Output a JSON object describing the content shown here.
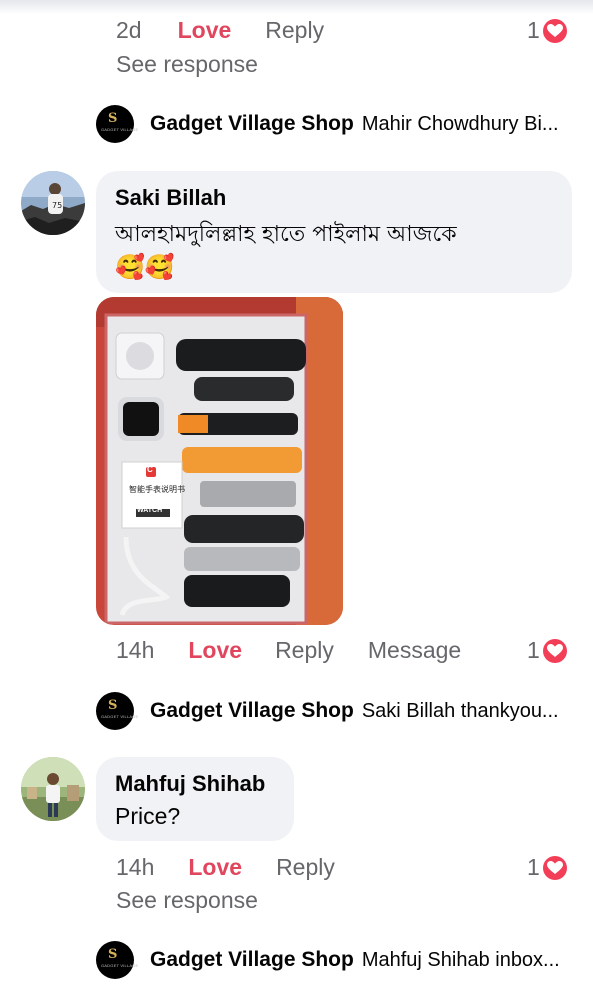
{
  "comments": [
    {
      "time": "2d",
      "love_label": "Love",
      "reply_label": "Reply",
      "reaction_count": "1",
      "see_response": "See response",
      "page_reply": {
        "name": "Gadget Village Shop",
        "text": "Mahir Chowdhury Bi..."
      }
    },
    {
      "author": "Saki Billah",
      "text": "আলহামদুলিল্লাহ হাতে পাইলাম আজকে",
      "emoji": "🥰🥰",
      "photo_label_badge": "C",
      "photo_label_watch": "WATCH",
      "photo_label_chinese": "智能手表说明书",
      "time": "14h",
      "love_label": "Love",
      "reply_label": "Reply",
      "message_label": "Message",
      "reaction_count": "1",
      "page_reply": {
        "name": "Gadget Village Shop",
        "text": "Saki Billah thankyou..."
      }
    },
    {
      "author": "Mahfuj Shihab",
      "text": "Price?",
      "time": "14h",
      "love_label": "Love",
      "reply_label": "Reply",
      "reaction_count": "1",
      "see_response": "See response",
      "page_reply": {
        "name": "Gadget Village Shop",
        "text": "Mahfuj Shihab inbox..."
      }
    }
  ],
  "shop_logo_letter": "S",
  "shop_logo_text": "GADGET VILLAGE",
  "colors": {
    "love": "#e0465e",
    "heart": "#f33e58",
    "bubble": "#f0f2f5",
    "meta": "#65676b"
  }
}
